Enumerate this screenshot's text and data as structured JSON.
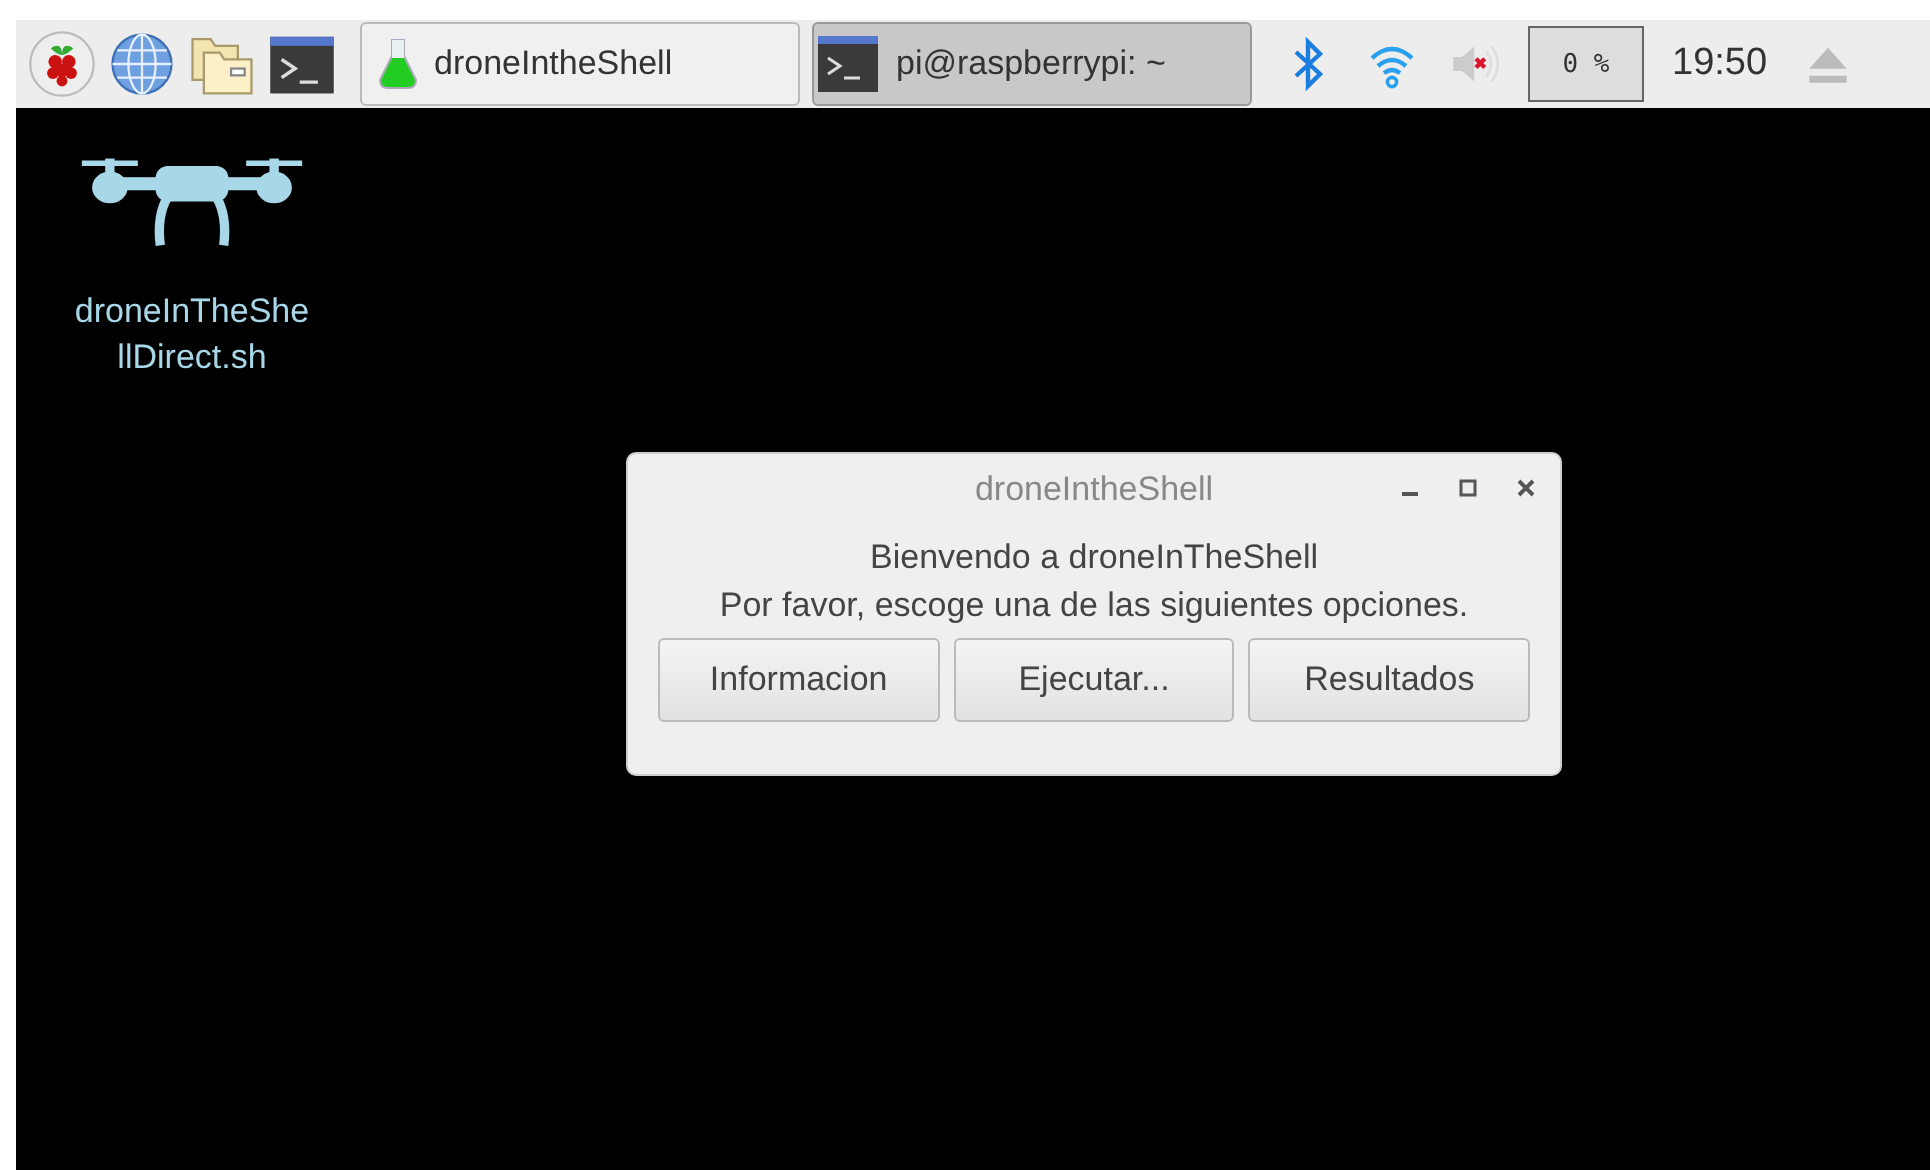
{
  "taskbar": {
    "launchers": [
      {
        "kind": "menu"
      },
      {
        "kind": "browser"
      },
      {
        "kind": "files"
      },
      {
        "kind": "terminal"
      }
    ],
    "windows": [
      {
        "kind": "flask",
        "label": "droneIntheShell",
        "selected": false
      },
      {
        "kind": "terminal",
        "label": "pi@raspberrypi: ~",
        "selected": true
      }
    ],
    "volume": {
      "muted": true
    },
    "cpu": "0 %",
    "clock": "19:50"
  },
  "desktop": {
    "icons": [
      {
        "label": "droneInTheShe\nllDirect.sh"
      }
    ]
  },
  "dialog": {
    "title": "droneIntheShell",
    "message": [
      "Bienvendo a droneInTheShell",
      "Por favor, escoge una de las siguientes opciones."
    ],
    "buttons": [
      "Informacion",
      "Ejecutar...",
      "Resultados"
    ]
  }
}
